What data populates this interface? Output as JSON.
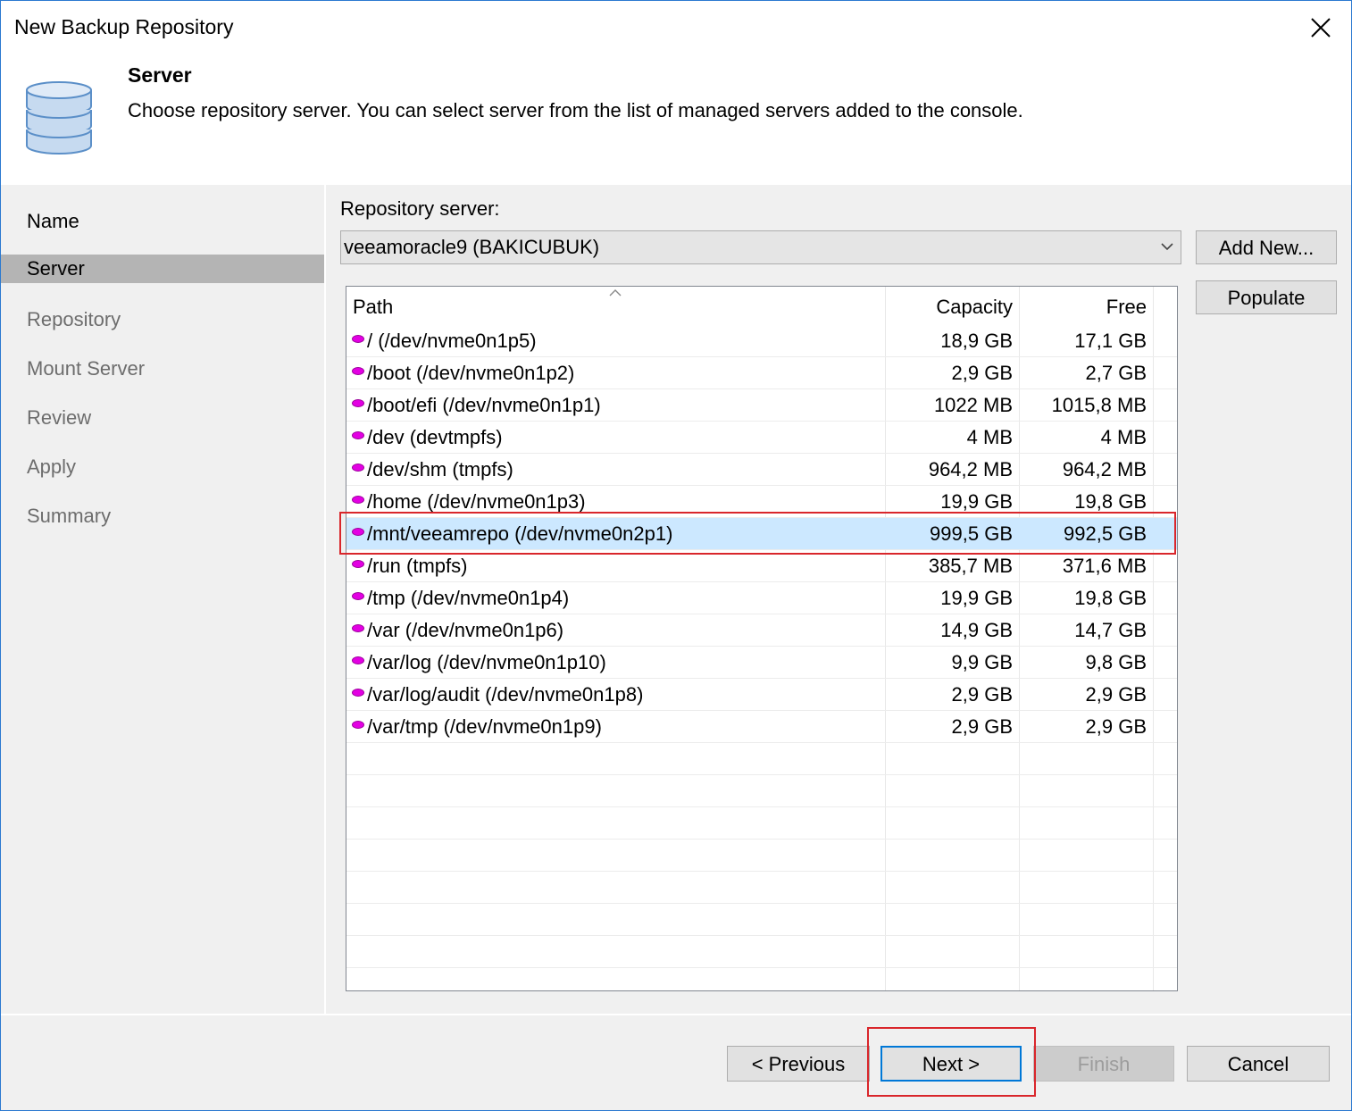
{
  "window": {
    "title": "New Backup Repository"
  },
  "header": {
    "step_title": "Server",
    "step_description": "Choose repository server. You can select server from the list of managed servers added to the console.",
    "icon": "database-icon"
  },
  "sidebar": {
    "items": [
      {
        "label": "Name",
        "state": "done"
      },
      {
        "label": "Server",
        "state": "active"
      },
      {
        "label": "Repository",
        "state": "pending"
      },
      {
        "label": "Mount Server",
        "state": "pending"
      },
      {
        "label": "Review",
        "state": "pending"
      },
      {
        "label": "Apply",
        "state": "pending"
      },
      {
        "label": "Summary",
        "state": "pending"
      }
    ]
  },
  "server": {
    "label": "Repository server:",
    "selected": "veeamoracle9 (BAKICUBUK)",
    "add_new_label": "Add New...",
    "populate_label": "Populate"
  },
  "grid": {
    "columns": {
      "path": "Path",
      "capacity": "Capacity",
      "free": "Free"
    },
    "rows": [
      {
        "path": "/ (/dev/nvme0n1p5)",
        "capacity": "18,9 GB",
        "free": "17,1 GB"
      },
      {
        "path": "/boot (/dev/nvme0n1p2)",
        "capacity": "2,9 GB",
        "free": "2,7 GB"
      },
      {
        "path": "/boot/efi (/dev/nvme0n1p1)",
        "capacity": "1022 MB",
        "free": "1015,8 MB"
      },
      {
        "path": "/dev (devtmpfs)",
        "capacity": "4 MB",
        "free": "4 MB"
      },
      {
        "path": "/dev/shm (tmpfs)",
        "capacity": "964,2 MB",
        "free": "964,2 MB"
      },
      {
        "path": "/home (/dev/nvme0n1p3)",
        "capacity": "19,9 GB",
        "free": "19,8 GB"
      },
      {
        "path": "/mnt/veeamrepo (/dev/nvme0n2p1)",
        "capacity": "999,5 GB",
        "free": "992,5 GB",
        "selected": true
      },
      {
        "path": "/run (tmpfs)",
        "capacity": "385,7 MB",
        "free": "371,6 MB"
      },
      {
        "path": "/tmp (/dev/nvme0n1p4)",
        "capacity": "19,9 GB",
        "free": "19,8 GB"
      },
      {
        "path": "/var (/dev/nvme0n1p6)",
        "capacity": "14,9 GB",
        "free": "14,7 GB"
      },
      {
        "path": "/var/log (/dev/nvme0n1p10)",
        "capacity": "9,9 GB",
        "free": "9,8 GB"
      },
      {
        "path": "/var/log/audit (/dev/nvme0n1p8)",
        "capacity": "2,9 GB",
        "free": "2,9 GB"
      },
      {
        "path": "/var/tmp (/dev/nvme0n1p9)",
        "capacity": "2,9 GB",
        "free": "2,9 GB"
      }
    ]
  },
  "footer": {
    "previous_label": "< Previous",
    "next_label": "Next >",
    "finish_label": "Finish",
    "cancel_label": "Cancel"
  },
  "colors": {
    "selected_row": "#cce8ff",
    "highlight_box": "#d9262b",
    "drive_dot": "#e300e3",
    "default_button_border": "#0078d7"
  }
}
